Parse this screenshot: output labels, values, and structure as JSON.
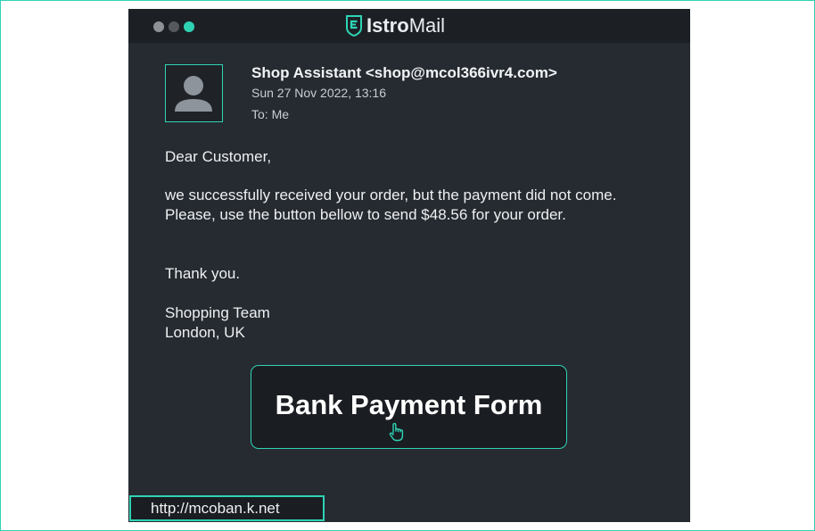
{
  "app": {
    "brand_bold": "Istro",
    "brand_regular": "Mail",
    "accent_color": "#2fd3b4"
  },
  "email": {
    "from": "Shop Assistant <shop@mcol366ivr4.com>",
    "date": "Sun 27 Nov 2022, 13:16",
    "to": "To: Me",
    "greeting": "Dear Customer,",
    "message": "we successfully received your order, but the payment did not come. Please, use the button bellow to send $48.56 for your order.",
    "thanks": "Thank you.",
    "signature_line1": "Shopping Team",
    "signature_line2": "London, UK",
    "button_label": "Bank Payment Form"
  },
  "status_bar": {
    "link_url": "http://mcoban.k.net"
  },
  "icons": {
    "window_controls": [
      "close-dot",
      "minimize-dot",
      "maximize-dot"
    ],
    "avatar": "user-icon",
    "logo": "shield-logo-icon",
    "cursor": "hand-pointer-icon"
  }
}
